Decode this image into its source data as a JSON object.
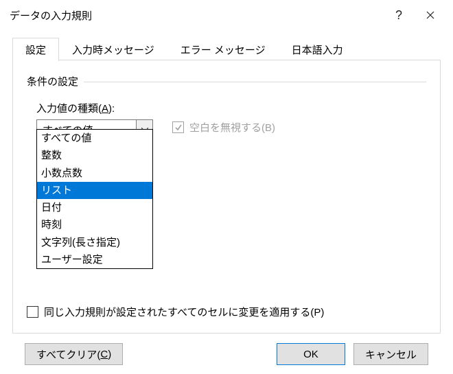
{
  "title": "データの入力規則",
  "tabs": {
    "settings": "設定",
    "input_msg": "入力時メッセージ",
    "error_msg": "エラー メッセージ",
    "ime": "日本語入力"
  },
  "group": {
    "condition": "条件の設定"
  },
  "field": {
    "allow_label_prefix": "入力値の種類(",
    "allow_label_hotkey": "A",
    "allow_label_suffix": "):",
    "allow_value": "すべての値"
  },
  "options": {
    "any": "すべての値",
    "int": "整数",
    "decimal": "小数点数",
    "list": "リスト",
    "date": "日付",
    "time": "時刻",
    "textlen": "文字列(長さ指定)",
    "custom": "ユーザー設定"
  },
  "checkbox": {
    "ignore_blank": "空白を無視する(B)",
    "apply_same": "同じ入力規則が設定されたすべてのセルに変更を適用する(P)"
  },
  "buttons": {
    "clear_prefix": "すべてクリア(",
    "clear_hotkey": "C",
    "clear_suffix": ")",
    "ok": "OK",
    "cancel": "キャンセル"
  }
}
